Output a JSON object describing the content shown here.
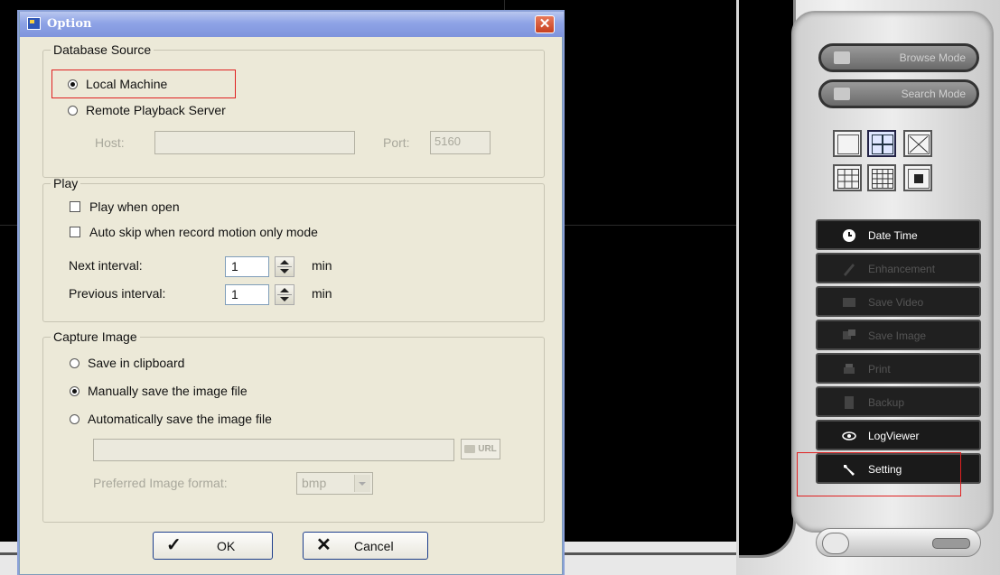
{
  "dialog": {
    "title": "Option",
    "database_source": {
      "legend": "Database Source",
      "local_label": "Local Machine",
      "local_selected": true,
      "remote_label": "Remote Playback Server",
      "host_label": "Host:",
      "host_value": "",
      "port_label": "Port:",
      "port_value": "5160"
    },
    "play": {
      "legend": "Play",
      "play_when_open": "Play when open",
      "play_when_open_checked": false,
      "auto_skip": "Auto skip when record motion only mode",
      "auto_skip_checked": false,
      "next_interval_label": "Next interval:",
      "next_interval_value": "1",
      "next_interval_unit": "min",
      "previous_interval_label": "Previous interval:",
      "previous_interval_value": "1",
      "previous_interval_unit": "min"
    },
    "capture": {
      "legend": "Capture Image",
      "clipboard": "Save in clipboard",
      "manual": "Manually save the image file",
      "manual_selected": true,
      "auto": "Automatically save the image file",
      "path_value": "",
      "url_label": "URL",
      "format_label": "Preferred Image format:",
      "format_value": "bmp"
    },
    "ok_label": "OK",
    "cancel_label": "Cancel"
  },
  "panel": {
    "browse_mode": "Browse Mode",
    "search_mode": "Search Mode",
    "buttons": [
      {
        "label": "Date Time",
        "enabled": true,
        "icon": "clock-icon"
      },
      {
        "label": "Enhancement",
        "enabled": false,
        "icon": "pencil-icon"
      },
      {
        "label": "Save Video",
        "enabled": false,
        "icon": "film-icon"
      },
      {
        "label": "Save Image",
        "enabled": false,
        "icon": "image-icon"
      },
      {
        "label": "Print",
        "enabled": false,
        "icon": "printer-icon"
      },
      {
        "label": "Backup",
        "enabled": false,
        "icon": "backup-icon"
      },
      {
        "label": "LogViewer",
        "enabled": true,
        "icon": "eye-icon"
      },
      {
        "label": "Setting",
        "enabled": true,
        "icon": "wrench-icon"
      }
    ]
  },
  "colors": {
    "highlight": "#e02020",
    "dialog_bg": "#ece9d8",
    "titlebar": "#8ea3e6"
  }
}
